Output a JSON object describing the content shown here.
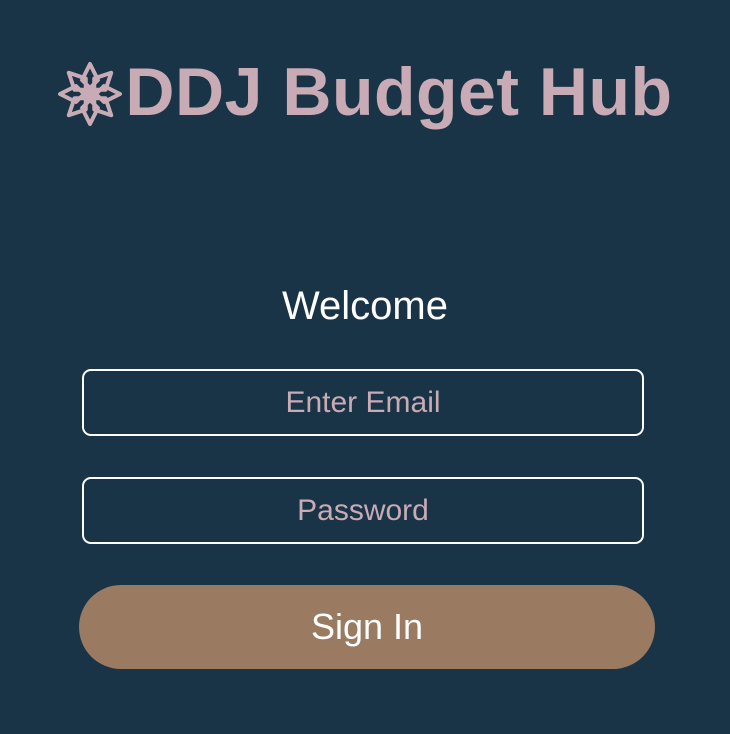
{
  "header": {
    "logo_icon": "flower-icon",
    "title": "DDJ Budget Hub"
  },
  "login": {
    "welcome": "Welcome",
    "email_placeholder": "Enter Email",
    "password_placeholder": "Password",
    "sign_in_label": "Sign In"
  },
  "colors": {
    "background": "#193347",
    "accent": "#c8abb4",
    "button": "#9a7b62",
    "field_border": "#ffffff"
  }
}
